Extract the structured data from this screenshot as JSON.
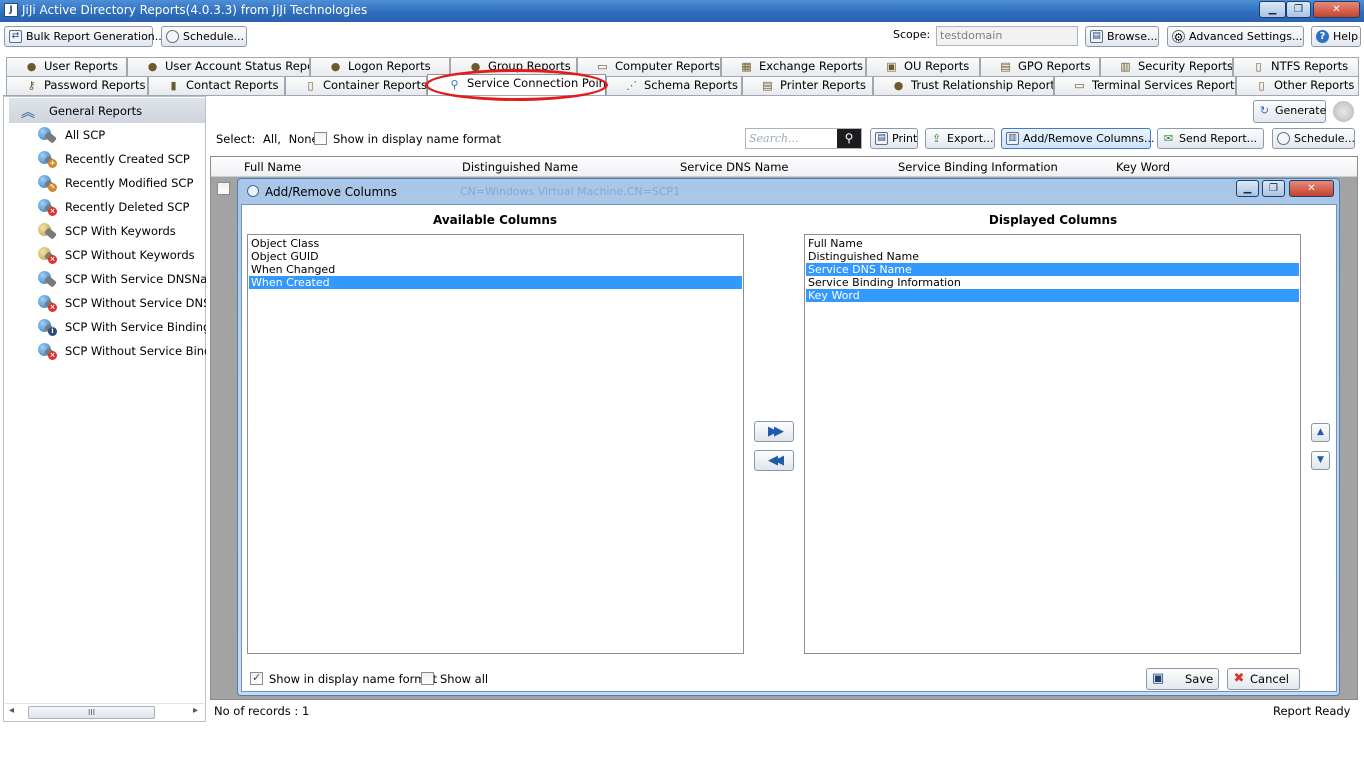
{
  "window": {
    "title": "JiJi Active Directory Reports(4.0.3.3) from JiJi Technologies",
    "app_icon": "J",
    "minimize": "▁",
    "maximize": "❐",
    "close": "✕"
  },
  "toolbar": {
    "bulk_report": "Bulk Report Generation...",
    "schedule": "Schedule...",
    "scope_label": "Scope:",
    "scope_value": "testdomain",
    "browse": "Browse...",
    "advanced_settings": "Advanced Settings...",
    "help": "Help"
  },
  "tabs_row1": [
    {
      "label": "User Reports",
      "icon": "user-icon"
    },
    {
      "label": "User Account Status Reports",
      "icon": "user-status-icon"
    },
    {
      "label": "Logon Reports",
      "icon": "logon-icon"
    },
    {
      "label": "Group Reports",
      "icon": "group-icon"
    },
    {
      "label": "Computer Reports",
      "icon": "computer-icon"
    },
    {
      "label": "Exchange Reports",
      "icon": "exchange-icon"
    },
    {
      "label": "OU Reports",
      "icon": "ou-icon"
    },
    {
      "label": "GPO Reports",
      "icon": "gpo-icon"
    },
    {
      "label": "Security Reports",
      "icon": "security-icon"
    },
    {
      "label": "NTFS Reports",
      "icon": "ntfs-icon"
    }
  ],
  "tabs_row2": [
    {
      "label": "Password Reports",
      "icon": "key-icon"
    },
    {
      "label": "Contact Reports",
      "icon": "contact-icon"
    },
    {
      "label": "Container Reports",
      "icon": "container-icon"
    },
    {
      "label": "Service Connection Point",
      "icon": "scp-icon",
      "active": true
    },
    {
      "label": "Schema Reports",
      "icon": "schema-icon"
    },
    {
      "label": "Printer Reports",
      "icon": "printer-icon"
    },
    {
      "label": "Trust Relationship Reports",
      "icon": "trust-icon"
    },
    {
      "label": "Terminal Services Reports",
      "icon": "terminal-icon"
    },
    {
      "label": "Other Reports",
      "icon": "other-icon"
    }
  ],
  "left_panel": {
    "group_title": "General Reports",
    "items": [
      {
        "label": "All SCP",
        "marker": ""
      },
      {
        "label": "Recently Created SCP",
        "marker": "created"
      },
      {
        "label": "Recently Modified SCP",
        "marker": "modified"
      },
      {
        "label": "Recently Deleted SCP",
        "marker": "deleted"
      },
      {
        "label": "SCP With Keywords",
        "marker": "keywords"
      },
      {
        "label": "SCP Without Keywords",
        "marker": "no-keywords"
      },
      {
        "label": "SCP With Service DNSName",
        "marker": "dns"
      },
      {
        "label": "SCP Without Service DNSName",
        "marker": "no-dns"
      },
      {
        "label": "SCP With Service Binding Information",
        "marker": "binding"
      },
      {
        "label": "SCP Without Service Binding Information",
        "marker": "no-binding"
      }
    ],
    "scroll_thumb": "III",
    "scroll_left": "◂",
    "scroll_right": "▸"
  },
  "report_toolbar": {
    "select_label": "Select:",
    "select_all": "All,",
    "select_none": "None",
    "show_display_name": "Show in display name format",
    "search_placeholder": "Search...",
    "print": "Print",
    "export": "Export...",
    "add_remove_columns": "Add/Remove Columns...",
    "send_report": "Send Report...",
    "schedule": "Schedule...",
    "generate": "Generate"
  },
  "grid": {
    "columns": [
      "Full Name",
      "Distinguished Name",
      "Service DNS Name",
      "Service Binding Information",
      "Key Word"
    ]
  },
  "dialog": {
    "title": "Add/Remove Columns",
    "ghost_title": "CN=Windows Virtual Machine,CN=SCP1",
    "available_title": "Available Columns",
    "displayed_title": "Displayed Columns",
    "available": [
      {
        "label": "Object Class",
        "selected": false
      },
      {
        "label": "Object GUID",
        "selected": false
      },
      {
        "label": "When Changed",
        "selected": false
      },
      {
        "label": "When Created",
        "selected": true
      }
    ],
    "displayed": [
      {
        "label": "Full Name",
        "selected": false
      },
      {
        "label": "Distinguished Name",
        "selected": false
      },
      {
        "label": "Service DNS Name",
        "selected": true
      },
      {
        "label": "Service Binding Information",
        "selected": false
      },
      {
        "label": "Key Word",
        "selected": true
      }
    ],
    "move_right": "▶▶",
    "move_left": "◀◀",
    "move_up": "▲",
    "move_down": "▼",
    "show_display_name": "Show in display name format",
    "show_display_name_checked": true,
    "show_all": "Show all",
    "show_all_checked": false,
    "save": "Save",
    "cancel": "Cancel"
  },
  "status": {
    "records": "No of records : 1",
    "state": "Report Ready"
  },
  "colors": {
    "title_bar": "#2f6fbf",
    "selection": "#3399ff",
    "highlight_ring": "#e21b1b",
    "grid_background": "#a3a3a3"
  }
}
